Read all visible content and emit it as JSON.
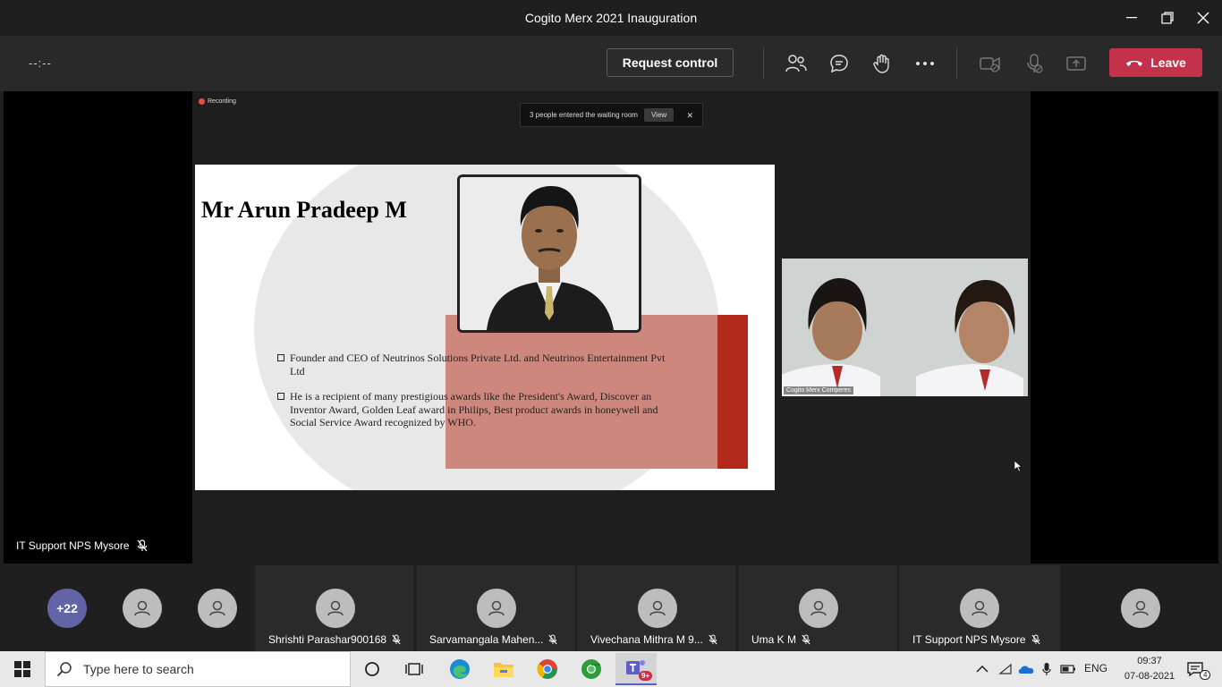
{
  "window": {
    "title": "Cogito Merx 2021 Inauguration"
  },
  "toolbar": {
    "timer": "--:--",
    "request_control": "Request control",
    "leave": "Leave"
  },
  "stage": {
    "recording_label": "Recording",
    "waiting_room": {
      "message": "3 people entered the waiting room",
      "view_label": "View"
    },
    "participant_name": "IT Support NPS Mysore"
  },
  "slide": {
    "name": "Mr Arun Pradeep M",
    "bullets": [
      "Founder and CEO of Neutrinos Solutions Private Ltd. and Neutrinos Entertainment Pvt Ltd",
      "He is a recipient of many prestigious awards like the President's Award, Discover an Inventor Award, Golden Leaf award in Philips, Best product awards in honeywell and Social Service Award recognized by WHO."
    ]
  },
  "camera": {
    "label": "Cogito Merx Comperes"
  },
  "participants": {
    "overflow": "+22",
    "tiles": [
      "Shrishti Parashar900168",
      "Sarvamangala Mahen...",
      "Vivechana Mithra M 9...",
      "Uma K M",
      "IT Support NPS Mysore"
    ]
  },
  "taskbar": {
    "search_placeholder": "Type here to search",
    "teams_badge": "9+",
    "lang": "ENG",
    "time": "09:37",
    "date": "07-08-2021",
    "notifications": "4"
  }
}
